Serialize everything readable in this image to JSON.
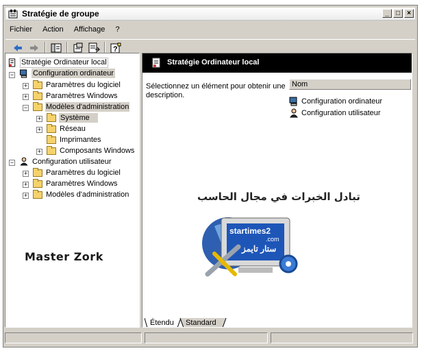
{
  "window": {
    "title": "Stratégie de groupe"
  },
  "menu": {
    "items": [
      "Fichier",
      "Action",
      "Affichage",
      "?"
    ]
  },
  "title_buttons": {
    "minimize": "_",
    "maximize": "□",
    "close": "×"
  },
  "tree": {
    "root": "Stratégie Ordinateur local",
    "computer_config": "Configuration ordinateur",
    "cc_software": "Paramètres du logiciel",
    "cc_windows": "Paramètres Windows",
    "cc_admin": "Modèles d'administration",
    "cc_admin_system": "Système",
    "cc_admin_network": "Réseau",
    "cc_admin_printers": "Imprimantes",
    "cc_admin_components": "Composants Windows",
    "user_config": "Configuration utilisateur",
    "uc_software": "Paramètres du logiciel",
    "uc_windows": "Paramètres Windows",
    "uc_admin": "Modèles d'administration"
  },
  "watermark_text": "Master Zork",
  "logo": {
    "arabic_title": "تبادل الخبرات في مجال الحاسب",
    "brand": "startimes2",
    "brand_suffix": ".com",
    "arabic_brand": "ستار تايمز"
  },
  "details": {
    "header": "Stratégie Ordinateur local",
    "description": "Sélectionnez un élément pour obtenir une description.",
    "column_name": "Nom",
    "items": [
      "Configuration ordinateur",
      "Configuration utilisateur"
    ]
  },
  "tabs": {
    "extended": "Étendu",
    "standard": "Standard"
  },
  "colors": {
    "header_bg": "#000000",
    "window_bg": "#d4d0c8",
    "folder": "#f5d26b"
  }
}
